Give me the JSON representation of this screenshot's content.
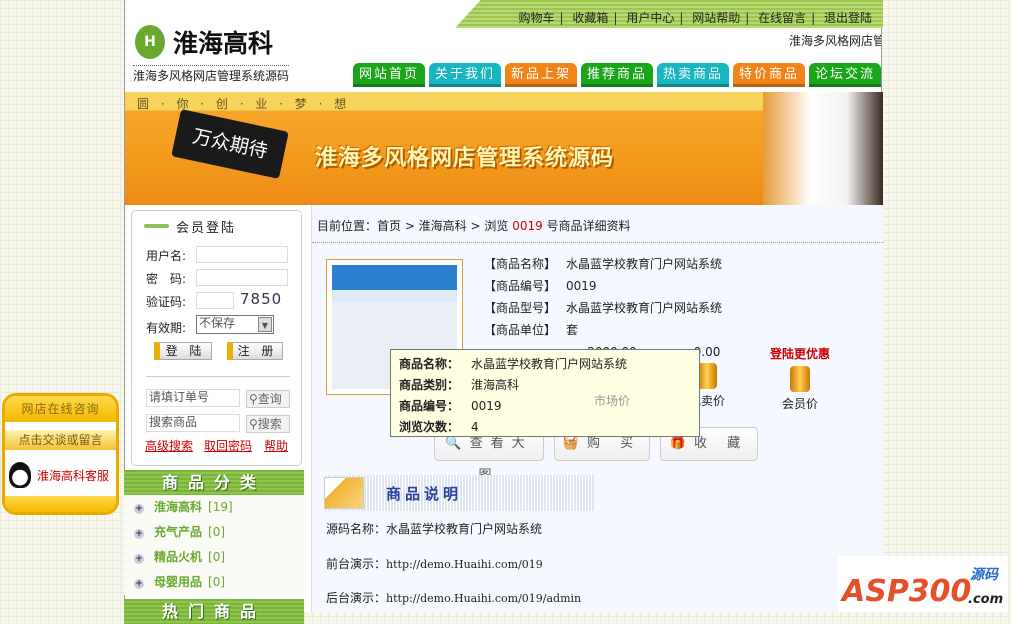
{
  "header": {
    "top_links": [
      "购物车",
      "收藏箱",
      "用户中心",
      "网站帮助",
      "在线留言",
      "退出登陆"
    ],
    "logo_text": "淮海高科",
    "logo_mark": "H",
    "logo_sub": "淮海多风格网店管理系统源码",
    "marquee": "淮海多风格网店管",
    "nav": [
      {
        "label": "网站首页",
        "color": "#1aa51a"
      },
      {
        "label": "关于我们",
        "color": "#19b5c0"
      },
      {
        "label": "新品上架",
        "color": "#f08418"
      },
      {
        "label": "推荐商品",
        "color": "#1aa51a"
      },
      {
        "label": "热卖商品",
        "color": "#19b5c0"
      },
      {
        "label": "特价商品",
        "color": "#f08418"
      },
      {
        "label": "论坛交流",
        "color": "#1aa51a"
      }
    ]
  },
  "banner": {
    "slogan": "圆 · 你 · 创 · 业 · 梦 · 想",
    "badge": "万众期待",
    "title": "淮海多风格网店管理系统源码"
  },
  "login": {
    "title": "会员登陆",
    "username_label": "用户名:",
    "password_label": "密　码:",
    "captcha_label": "验证码:",
    "captcha_code": "7850",
    "expiry_label": "有效期:",
    "expiry_value": "不保存",
    "login_button": "登 陆",
    "register_button": "注 册",
    "order_placeholder": "请填订单号",
    "order_button": "查询",
    "search_placeholder": "搜索商品",
    "search_button": "搜索",
    "links": [
      "高级搜索",
      "取回密码",
      "帮助"
    ]
  },
  "categories": {
    "title": "商品分类",
    "items": [
      {
        "name": "淮海高科",
        "count": "[19]"
      },
      {
        "name": "充气产品",
        "count": "[0]"
      },
      {
        "name": "精品火机",
        "count": "[0]"
      },
      {
        "name": "母婴用品",
        "count": "[0]"
      }
    ],
    "next_title": "热门商品"
  },
  "breadcrumb": {
    "prefix": "目前位置：首页 > 淮海高科 > 浏览 ",
    "id": "0019",
    "suffix": " 号商品详细资料"
  },
  "product": {
    "fields": [
      {
        "label": "【商品名称】",
        "value": "水晶蓝学校教育门户网站系统"
      },
      {
        "label": "【商品编号】",
        "value": "0019"
      },
      {
        "label": "【商品型号】",
        "value": "水晶蓝学校教育门户网站系统"
      },
      {
        "label": "【商品单位】",
        "value": "套"
      }
    ],
    "prices": [
      {
        "label": "市场价",
        "value": "2000.00"
      },
      {
        "label": "批卖价",
        "value": "0.00"
      },
      {
        "label": "会员价",
        "value": "登陆更优惠"
      }
    ],
    "buttons": [
      "查看大图",
      "购 买",
      "收 藏"
    ]
  },
  "tooltip": [
    {
      "label": "商品名称：",
      "value": "水晶蓝学校教育门户网站系统"
    },
    {
      "label": "商品类别：",
      "value": "淮海高科"
    },
    {
      "label": "商品编号：",
      "value": "0019"
    },
    {
      "label": "浏览次数：",
      "value": "4"
    }
  ],
  "description": {
    "title": "商品说明",
    "lines": [
      {
        "label": "源码名称：",
        "value": "水晶蓝学校教育门户网站系统"
      },
      {
        "label": "前台演示：",
        "value": "http://demo.Huaihi.com/019"
      },
      {
        "label": "后台演示：",
        "value": "http://demo.Huaihi.com/019/admin"
      }
    ]
  },
  "qq": {
    "title": "网店在线咨询",
    "subtitle": "点击交谈或留言",
    "service": "淮海高科客服"
  },
  "watermark": "ASP300源码.com"
}
